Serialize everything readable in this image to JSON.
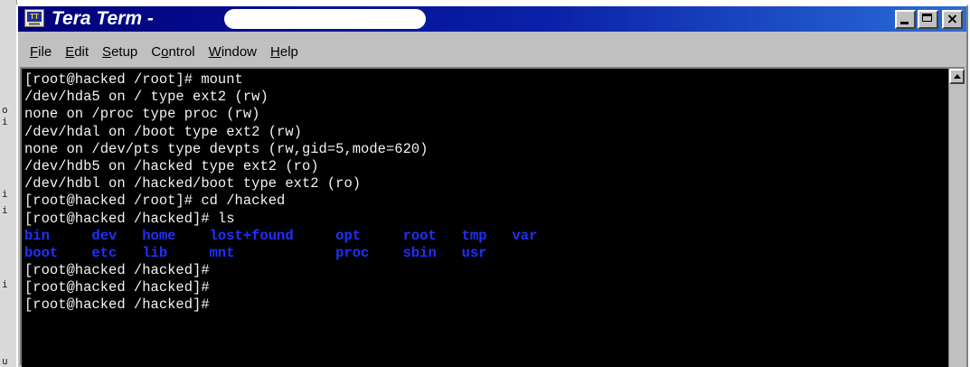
{
  "window": {
    "title": "Tera Term - ",
    "app_icon_text": "TT"
  },
  "left_edge_chars": [
    "o",
    "i",
    "i",
    "i",
    "i",
    "u"
  ],
  "menu": {
    "items": [
      {
        "underline": "F",
        "rest": "ile"
      },
      {
        "underline": "E",
        "rest": "dit"
      },
      {
        "underline": "S",
        "rest": "etup"
      },
      {
        "pre": "C",
        "underline": "o",
        "rest": "ntrol"
      },
      {
        "underline": "W",
        "rest": "indow"
      },
      {
        "underline": "H",
        "rest": "elp"
      }
    ]
  },
  "terminal": {
    "lines_before": [
      "[root@hacked /root]# mount",
      "/dev/hda5 on / type ext2 (rw)",
      "none on /proc type proc (rw)",
      "/dev/hdal on /boot type ext2 (rw)",
      "none on /dev/pts type devpts (rw,gid=5,mode=620)",
      "/dev/hdb5 on /hacked type ext2 (ro)",
      "/dev/hdbl on /hacked/boot type ext2 (ro)",
      "[root@hacked /root]# cd /hacked",
      "[root@hacked /hacked]# ls"
    ],
    "ls_rows": [
      [
        "bin",
        "dev",
        "home",
        "lost+found",
        "opt",
        "root",
        "tmp",
        "var"
      ],
      [
        "boot",
        "etc",
        "lib",
        "mnt",
        "",
        "proc",
        "sbin",
        "usr"
      ]
    ],
    "lines_after": [
      "[root@hacked /hacked]#",
      "[root@hacked /hacked]#",
      "[root@hacked /hacked]#"
    ],
    "ls_color": "#2030ff",
    "text_color": "#f2f2f2",
    "background": "#000000"
  }
}
